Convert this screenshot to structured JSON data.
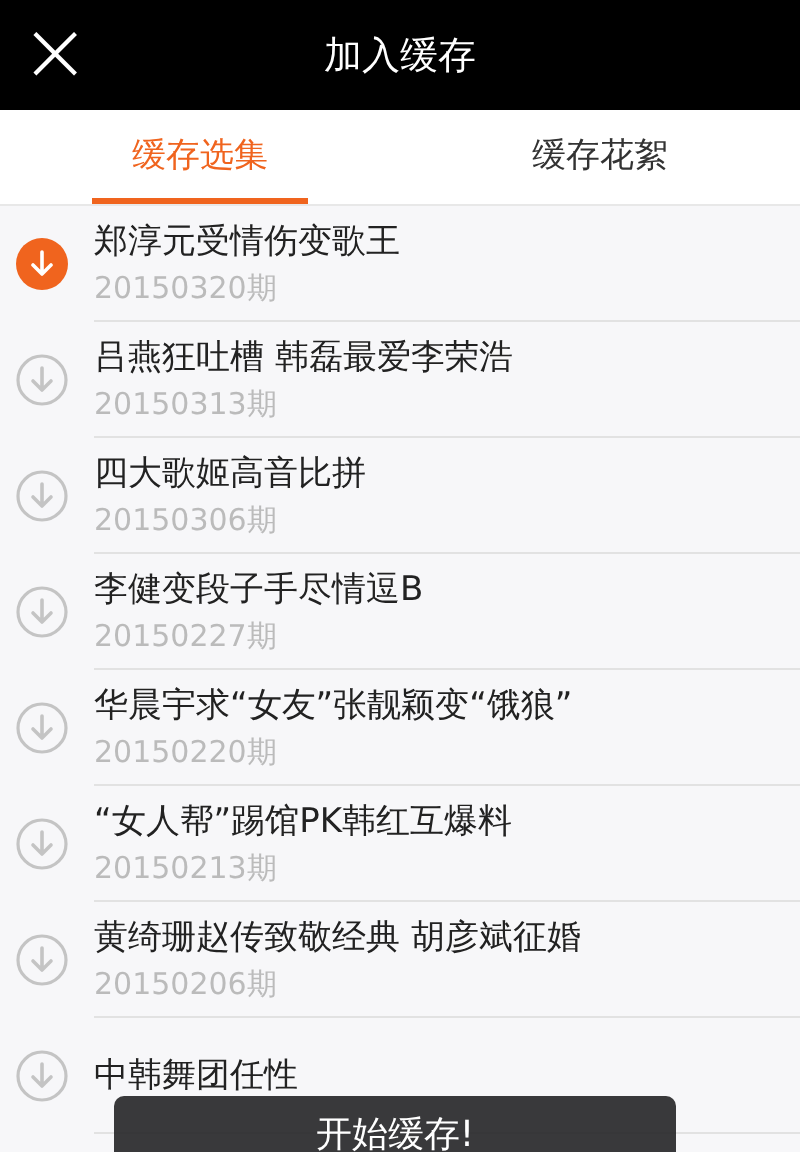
{
  "header": {
    "close": "×",
    "title": "加入缓存"
  },
  "tabs": [
    {
      "label": "缓存选集",
      "selected": true
    },
    {
      "label": "缓存花絮",
      "selected": false
    }
  ],
  "episodes": [
    {
      "title": "郑淳元受情伤变歌王",
      "date": "20150320期",
      "selected": true
    },
    {
      "title": "吕燕狂吐槽 韩磊最爱李荣浩",
      "date": "20150313期",
      "selected": false
    },
    {
      "title": "四大歌姬高音比拼",
      "date": "20150306期",
      "selected": false
    },
    {
      "title": "李健变段子手尽情逗B",
      "date": "20150227期",
      "selected": false
    },
    {
      "title": "华晨宇求“女友”张靓颖变“饿狼”",
      "date": "20150220期",
      "selected": false
    },
    {
      "title": "“女人帮”踢馆PK韩红互爆料",
      "date": "20150213期",
      "selected": false
    },
    {
      "title": "黄绮珊赵传致敬经典 胡彦斌征婚",
      "date": "20150206期",
      "selected": false
    },
    {
      "title": "中韩舞团任性",
      "selected": false
    }
  ],
  "toast": "开始缓存!"
}
